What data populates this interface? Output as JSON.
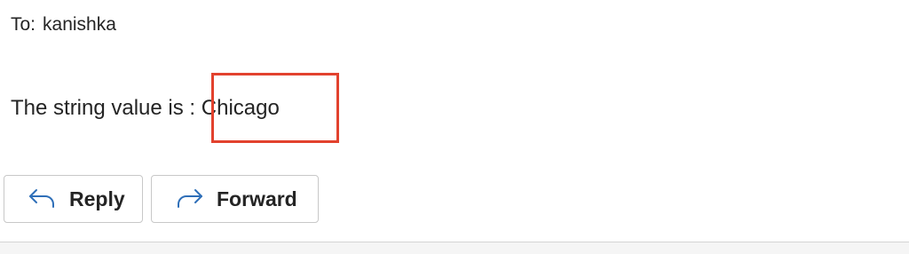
{
  "recipient": {
    "label": "To:",
    "name": "kanishka"
  },
  "message": {
    "text": "The string value is : ",
    "highlighted_value": "Chicago",
    "highlight_color": "#e2422e"
  },
  "actions": {
    "reply": {
      "label": "Reply",
      "icon": "reply-arrow-icon"
    },
    "forward": {
      "label": "Forward",
      "icon": "forward-arrow-icon"
    }
  },
  "accent_color": "#2f6fb8"
}
